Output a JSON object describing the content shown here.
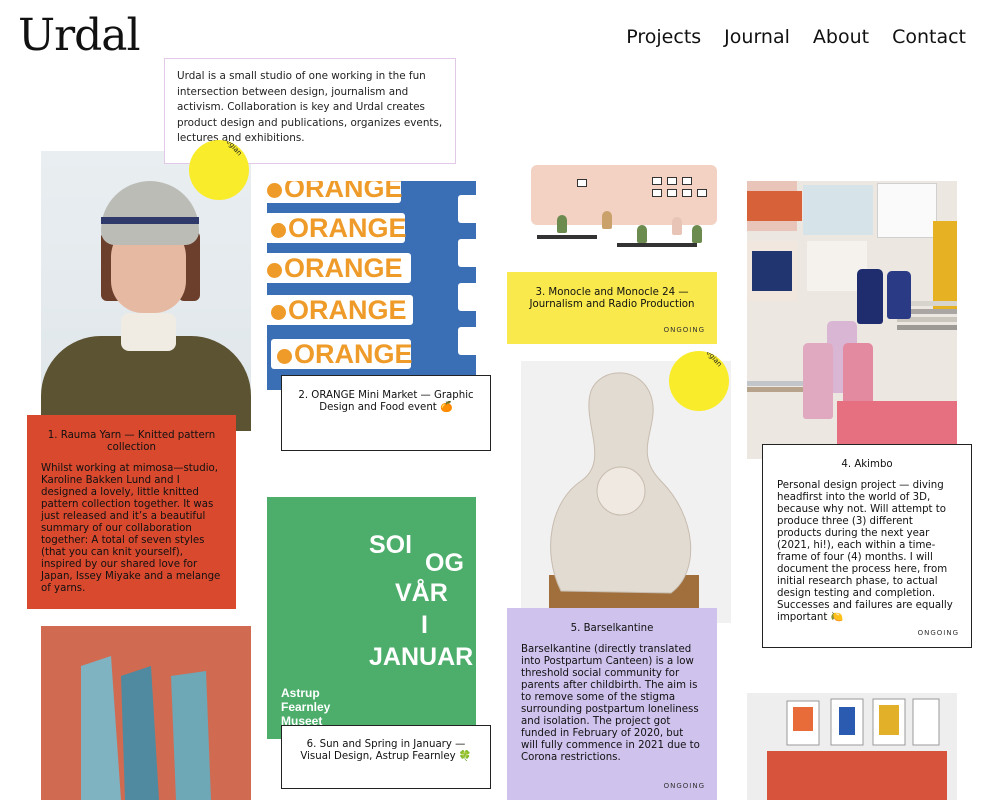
{
  "header": {
    "logo": "Urdal",
    "nav": [
      "Projects",
      "Journal",
      "About",
      "Contact"
    ]
  },
  "intro": "Urdal is a small studio of one working in the fun intersection between design, journalism and activism. Collaboration is key and Urdal creates product design and publications, organizes events, lectures and exhibitions.",
  "badge_text": "Only in Norwegian",
  "ongoing_label": "ONGOING",
  "projects": [
    {
      "title": "1.    Rauma Yarn — Knitted pattern collection",
      "description": "Whilst working at mimosa—studio, Karoline Bakken Lund and I designed a lovely, little knitted pattern collection together. It was just released and it’s a beautiful summary of our collaboration together: A total of seven styles (that you can knit yourself), inspired by our shared love for Japan, Issey Miyake and a melange of yarns."
    },
    {
      "title": "2.    ORANGE Mini Market — Graphic Design and Food event 🍊",
      "image_text": "ORANGE"
    },
    {
      "title": "3.    Monocle and Monocle 24 — Journalism and Radio Production"
    },
    {
      "title": "4.    Akimbo",
      "description": "Personal design project — diving headfirst into the world of 3D, because why not. Will attempt to produce three (3) different products during the next year (2021, hi!), each within a time-frame of four (4) months. I will document the process here, from initial research phase, to actual design testing and completion. Successes and failures are equally important 🍋"
    },
    {
      "title": "5.    Barselkantine",
      "description": "Barselkantine (directly translated into Postpartum Canteen) is a low threshold social community for parents after childbirth. The aim is to remove some of the stigma surrounding postpartum loneliness and isolation. The project got funded in February of 2020, but will fully commence in 2021 due to Corona restrictions."
    },
    {
      "title": "6.    Sun and Spring in January — Visual Design, Astrup Fearnley 🍀",
      "poster": {
        "w1": "SOl",
        "w2": "OG",
        "w3": "VÅR",
        "w4": "I",
        "w5": "JANUAR",
        "org1": "Astrup",
        "org2": "Fearnley",
        "org3": "Museet"
      }
    }
  ],
  "colors": {
    "card1": "#d8492e",
    "card3": "#f9e94c",
    "card5": "#cfc3ed",
    "badge": "#f9ec2b",
    "orange_bg": "#3a6fb6",
    "poster_bg": "#4dae6c"
  }
}
